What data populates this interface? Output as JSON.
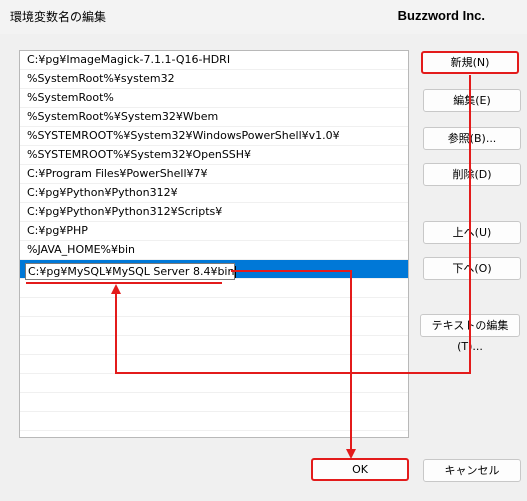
{
  "window": {
    "title": "環境変数名の編集",
    "brand": "Buzzword Inc."
  },
  "list": {
    "items": [
      "C:¥pg¥ImageMagick-7.1.1-Q16-HDRI",
      "%SystemRoot%¥system32",
      "%SystemRoot%",
      "%SystemRoot%¥System32¥Wbem",
      "%SYSTEMROOT%¥System32¥WindowsPowerShell¥v1.0¥",
      "%SYSTEMROOT%¥System32¥OpenSSH¥",
      "C:¥Program Files¥PowerShell¥7¥",
      "C:¥pg¥Python¥Python312¥",
      "C:¥pg¥Python¥Python312¥Scripts¥",
      "C:¥pg¥PHP",
      "%JAVA_HOME%¥bin"
    ],
    "editing_value": "C:¥pg¥MySQL¥MySQL Server 8.4¥bin"
  },
  "buttons": {
    "new": "新規(N)",
    "edit": "編集(E)",
    "browse": "参照(B)...",
    "delete": "削除(D)",
    "up": "上へ(U)",
    "down": "下へ(O)",
    "edit_text": "テキストの編集(T)...",
    "ok": "OK",
    "cancel": "キャンセル"
  },
  "colors": {
    "annotation": "#e31b1b",
    "selection": "#0078d7"
  }
}
